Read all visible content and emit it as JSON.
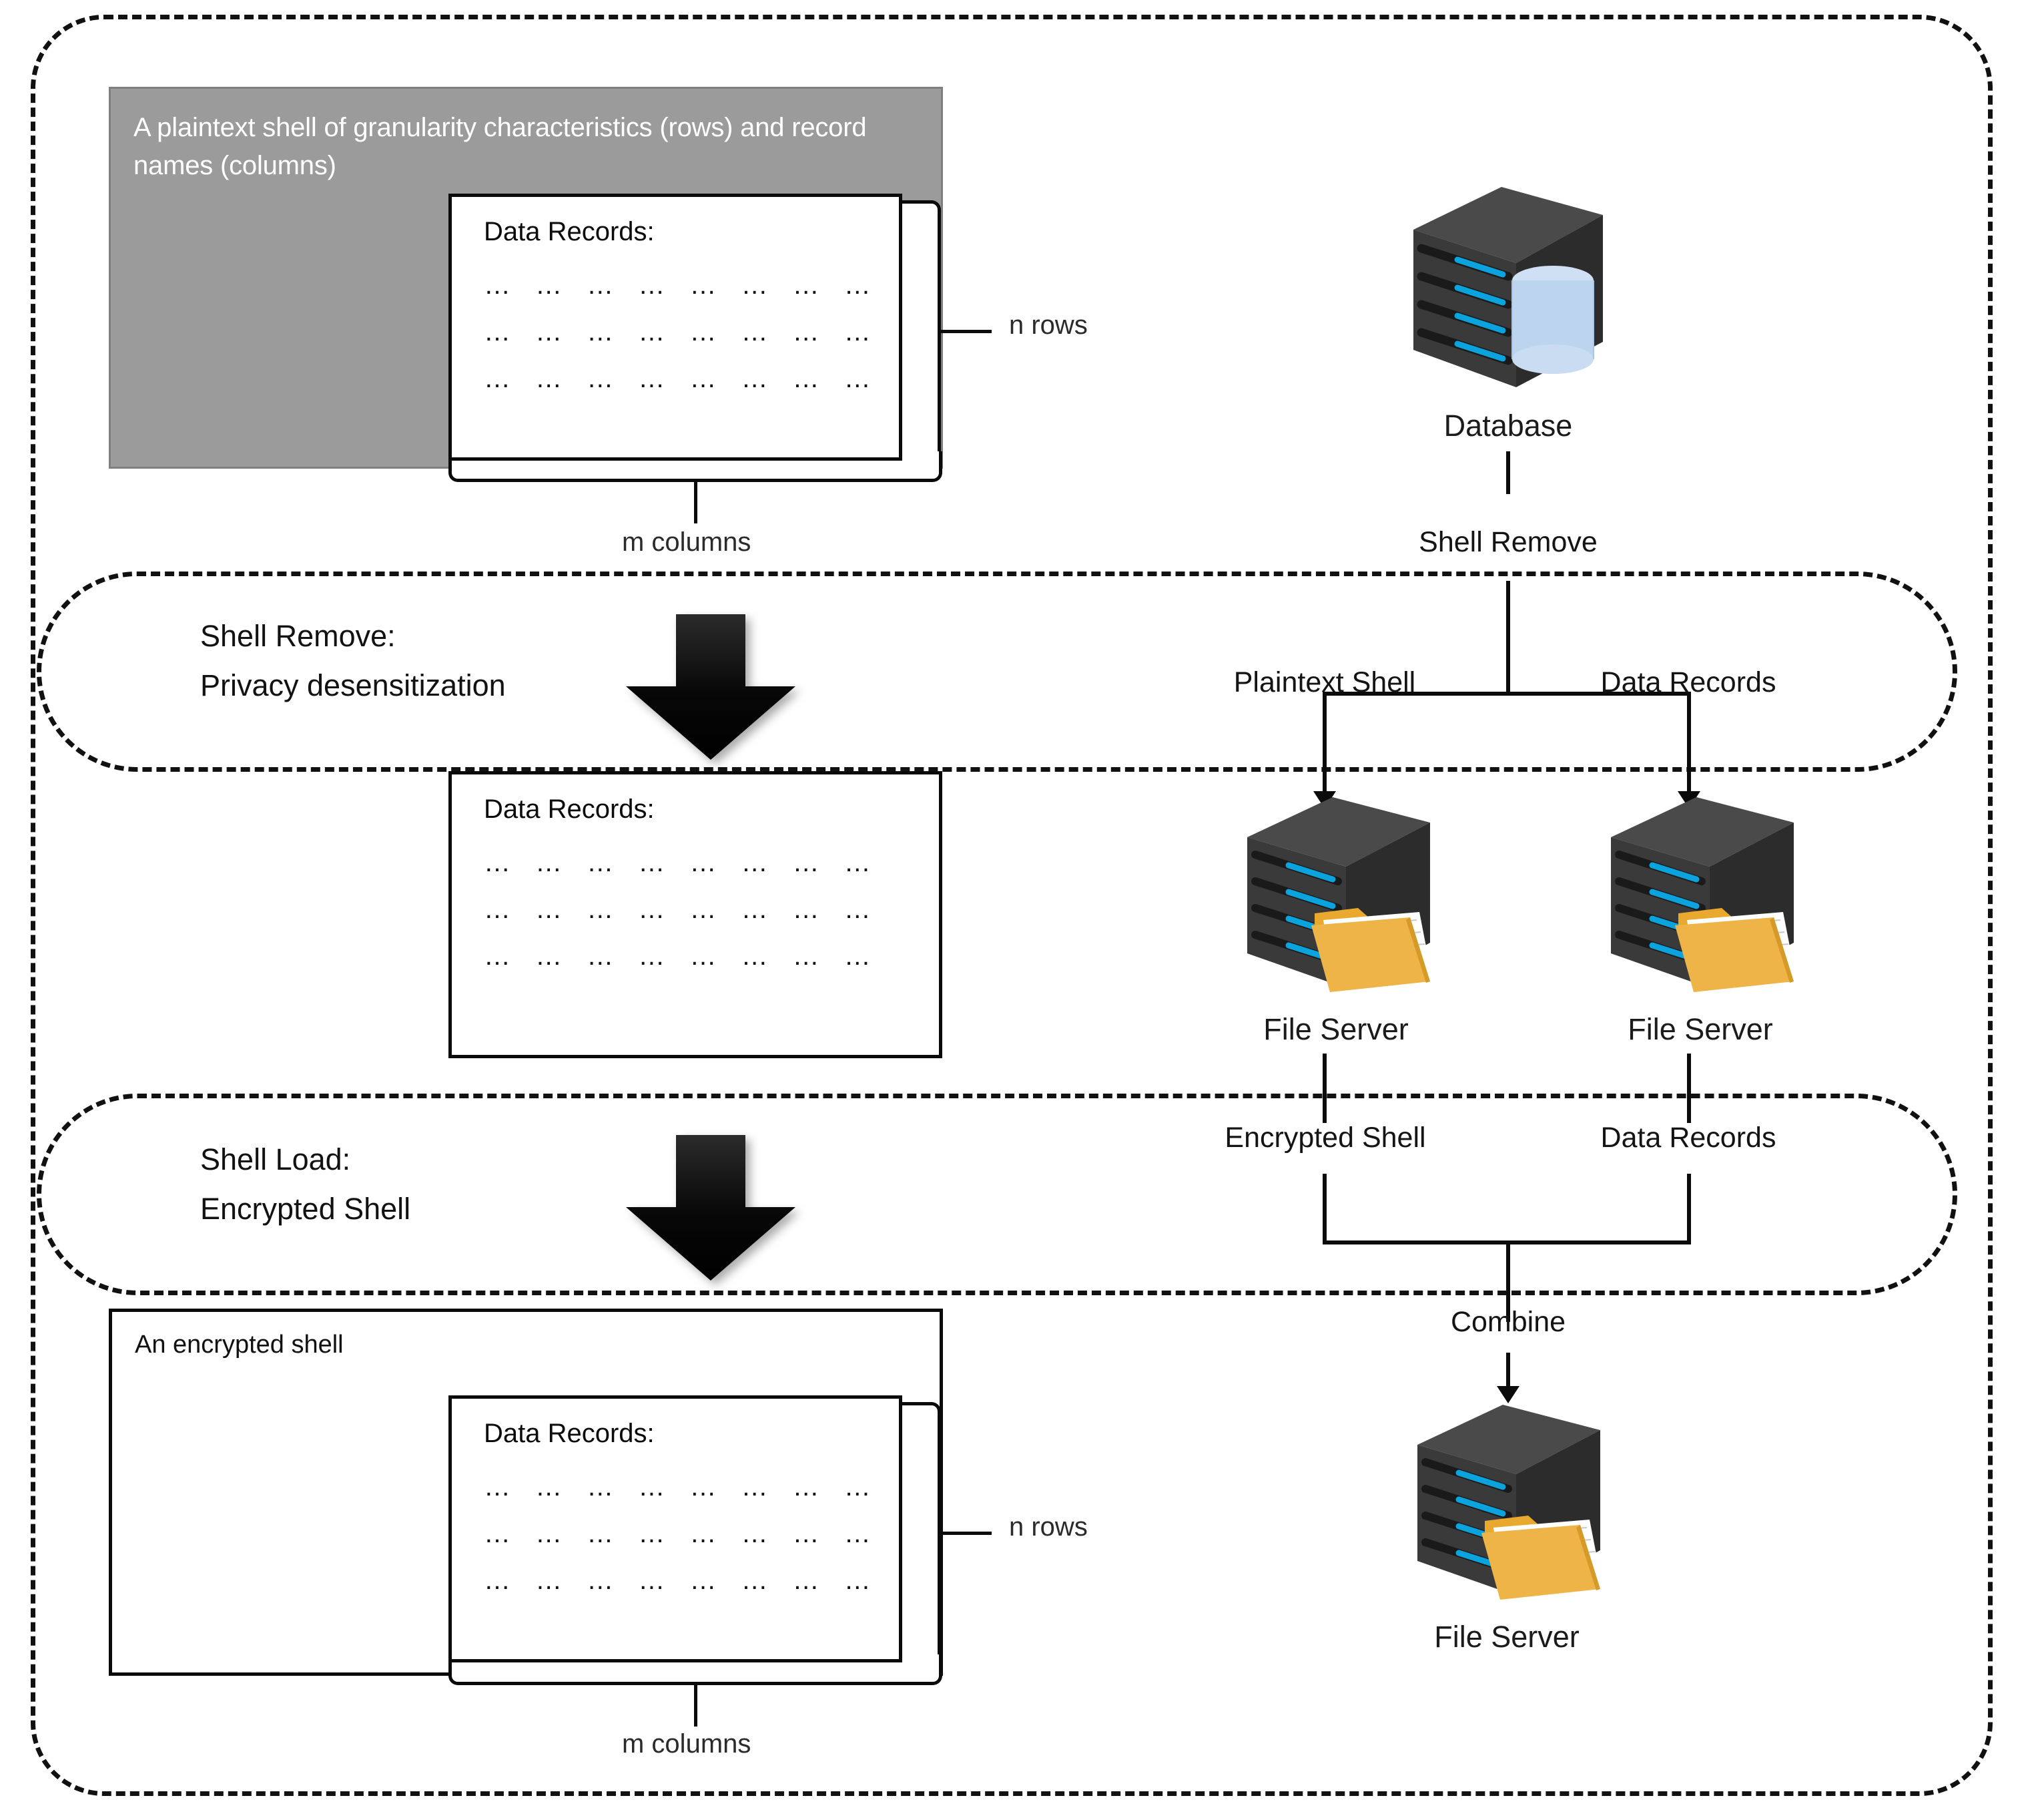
{
  "diagram": {
    "title": "Shell Remove and Shell Load data protection workflow",
    "gray_panel": {
      "caption": "A plaintext shell of granularity characteristics (rows) and record names (columns)"
    },
    "records_boxes": {
      "title": "Data Records:",
      "row_text": "… … … … … … … …",
      "rows": 3,
      "columns": 8
    },
    "encrypted_shell_panel": {
      "caption": "An encrypted shell"
    },
    "dimension_labels": {
      "rows_top": "n rows",
      "columns_top": "m columns",
      "rows_bottom": "n rows",
      "columns_bottom": "m columns"
    },
    "stages": [
      {
        "line1": "Shell Remove:",
        "line2": "Privacy desensitization"
      },
      {
        "line1": "Shell Load:",
        "line2": "Encrypted Shell"
      }
    ],
    "nodes": [
      {
        "id": "database",
        "caption": "Database",
        "icon": "database-server-icon"
      },
      {
        "id": "file-server-left",
        "caption": "File Server",
        "icon": "file-server-icon"
      },
      {
        "id": "file-server-right",
        "caption": "File Server",
        "icon": "file-server-icon"
      },
      {
        "id": "file-server-combined",
        "caption": "File Server",
        "icon": "file-server-icon"
      }
    ],
    "flow_labels": {
      "shell_remove": "Shell Remove",
      "plaintext_shell": "Plaintext Shell",
      "data_records_branch": "Data Records",
      "encrypted_shell": "Encrypted Shell",
      "data_records_merge": "Data Records",
      "combine": "Combine"
    },
    "colors": {
      "gray_panel_fill": "#9b9b9b",
      "gray_panel_border": "#7f7f7f",
      "line": "#0b0b0b",
      "server_body": "#3a3a3a",
      "server_slot": "#0aa3dd",
      "db_cylinder": "#bcd4ee",
      "folder": "#eab councils"
    }
  }
}
